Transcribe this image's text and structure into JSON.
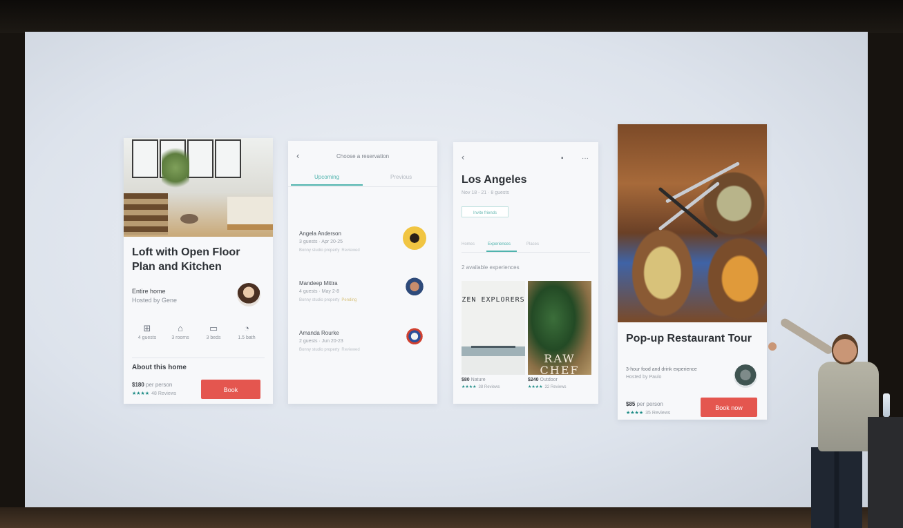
{
  "card_home": {
    "title": "Loft with Open Floor Plan and Kitchen",
    "type": "Entire home",
    "host": "Hosted by Gene",
    "amenities": [
      {
        "icon": "guests-icon",
        "label": "4 guests"
      },
      {
        "icon": "rooms-icon",
        "label": "3 rooms"
      },
      {
        "icon": "beds-icon",
        "label": "3 beds"
      },
      {
        "icon": "bath-icon",
        "label": "1.5 bath"
      }
    ],
    "about_label": "About this home",
    "price": "$180",
    "price_unit": "per person",
    "stars": "★★★★",
    "reviews": "48 Reviews",
    "book_label": "Book"
  },
  "card_reservations": {
    "back": "‹",
    "header": "Choose a reservation",
    "tabs": [
      "Upcoming",
      "Previous"
    ],
    "guests": [
      {
        "name": "Angela Anderson",
        "details": "3 guests · Apr 20-25",
        "status_prefix": "Bonny studio property",
        "status": "Reviewed"
      },
      {
        "name": "Mandeep Mittra",
        "details": "4 guests · May 2-8",
        "status_prefix": "Bonny studio property",
        "status": "Pending"
      },
      {
        "name": "Amanda Rourke",
        "details": "2 guests · Jun 20-23",
        "status_prefix": "Bonny studio property",
        "status": "Reviewed"
      }
    ]
  },
  "card_city": {
    "back": "‹",
    "share_icon": "▪",
    "more_icon": "···",
    "title": "Los Angeles",
    "dates": "Nov 18 - 21 · 8 guests",
    "invite_label": "Invite friends",
    "tabs": [
      "Homes",
      "Experiences",
      "Places"
    ],
    "count": "2 available experiences",
    "posters": [
      {
        "title": "ZEN EXPLORERS",
        "price": "$80",
        "category": "Nature",
        "stars": "★★★★",
        "reviews": "38 Reviews"
      },
      {
        "title": "RAW CHEF",
        "price": "$240",
        "category": "Outdoor",
        "stars": "★★★★",
        "reviews": "32 Reviews"
      }
    ]
  },
  "card_tour": {
    "title": "Pop-up Restaurant Tour",
    "description": "3-hour food and drink experience",
    "host": "Hosted by Paulo",
    "price": "$85",
    "price_unit": "per person",
    "stars": "★★★★",
    "reviews": "35 Reviews",
    "book_label": "Book now"
  },
  "colors": {
    "accent": "#4fb3ad",
    "button": "#e4564f",
    "star": "#1a8a84"
  }
}
